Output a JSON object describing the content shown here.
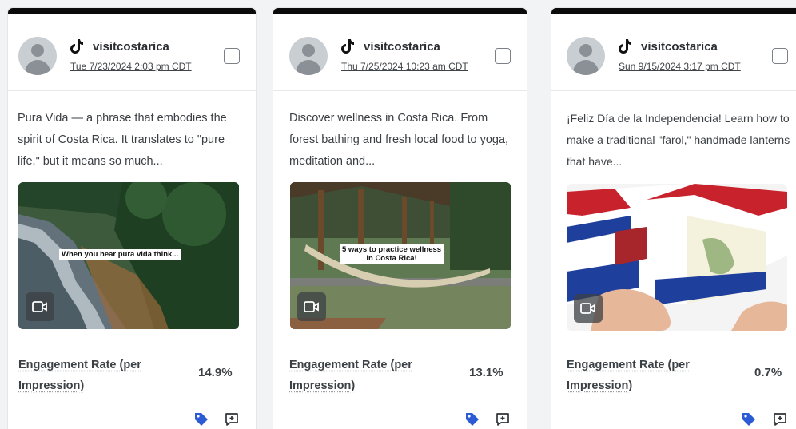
{
  "colors": {
    "tag_blue": "#2d5bd3",
    "card_top_border": "#0b0b0b",
    "text": "#3a3f44"
  },
  "cards": [
    {
      "platform_icon": "tiktok-icon",
      "handle": "visitcostarica",
      "timestamp": "Tue 7/23/2024 2:03 pm CDT",
      "text": "Pura Vida — a phrase that embodies the spirit of Costa Rica. It translates to \"pure life,\" but it means so much...",
      "media_caption": "When you hear pura vida think...",
      "media_type_icon": "video-icon",
      "metric_label": "Engagement Rate (per Impression)",
      "metric_value": "14.9%",
      "actions": [
        "tag-icon",
        "comment-plus-icon"
      ]
    },
    {
      "platform_icon": "tiktok-icon",
      "handle": "visitcostarica",
      "timestamp": "Thu 7/25/2024 10:23 am CDT",
      "text": "Discover wellness in Costa Rica. From forest bathing and fresh local food to yoga, meditation and...",
      "media_caption": "5 ways to practice wellness\nin Costa Rica!",
      "media_type_icon": "video-icon",
      "metric_label": "Engagement Rate (per Impression)",
      "metric_value": "13.1%",
      "actions": [
        "tag-icon",
        "comment-plus-icon"
      ]
    },
    {
      "platform_icon": "tiktok-icon",
      "handle": "visitcostarica",
      "timestamp": "Sun 9/15/2024 3:17 pm CDT",
      "text": "¡Feliz Día de la Independencia! Learn how to make a traditional \"farol,\" handmade lanterns that have...",
      "media_caption": "",
      "media_type_icon": "video-icon",
      "metric_label": "Engagement Rate (per Impression)",
      "metric_value": "0.7%",
      "actions": [
        "tag-icon",
        "comment-plus-icon"
      ]
    }
  ]
}
